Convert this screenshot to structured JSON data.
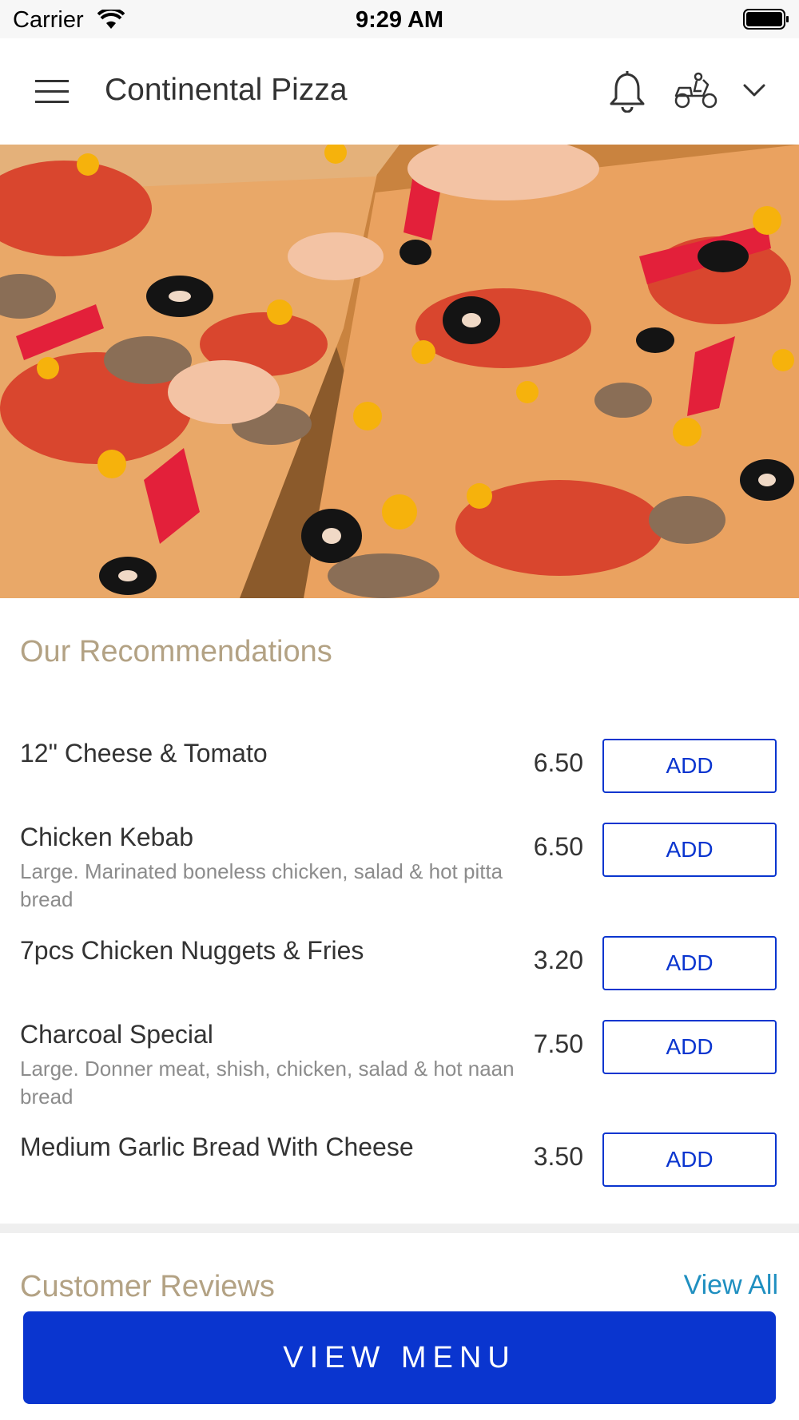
{
  "status_bar": {
    "carrier": "Carrier",
    "time": "9:29 AM"
  },
  "header": {
    "title": "Continental Pizza"
  },
  "recommendations": {
    "title": "Our Recommendations",
    "items": [
      {
        "name": "12\" Cheese & Tomato",
        "description": "",
        "price": "6.50",
        "button": "ADD"
      },
      {
        "name": "Chicken Kebab",
        "description": "Large. Marinated boneless chicken, salad & hot pitta bread",
        "price": "6.50",
        "button": "ADD"
      },
      {
        "name": "7pcs Chicken Nuggets & Fries",
        "description": "",
        "price": "3.20",
        "button": "ADD"
      },
      {
        "name": "Charcoal Special",
        "description": "Large. Donner meat, shish, chicken, salad & hot naan bread",
        "price": "7.50",
        "button": "ADD"
      },
      {
        "name": "Medium Garlic Bread With Cheese",
        "description": "",
        "price": "3.50",
        "button": "ADD"
      }
    ]
  },
  "reviews": {
    "title": "Customer Reviews",
    "view_all": "View All"
  },
  "footer": {
    "button": "VIEW MENU"
  },
  "colors": {
    "accent": "#0a35cf",
    "section_title": "#b3a284",
    "link": "#1f8fc0"
  }
}
